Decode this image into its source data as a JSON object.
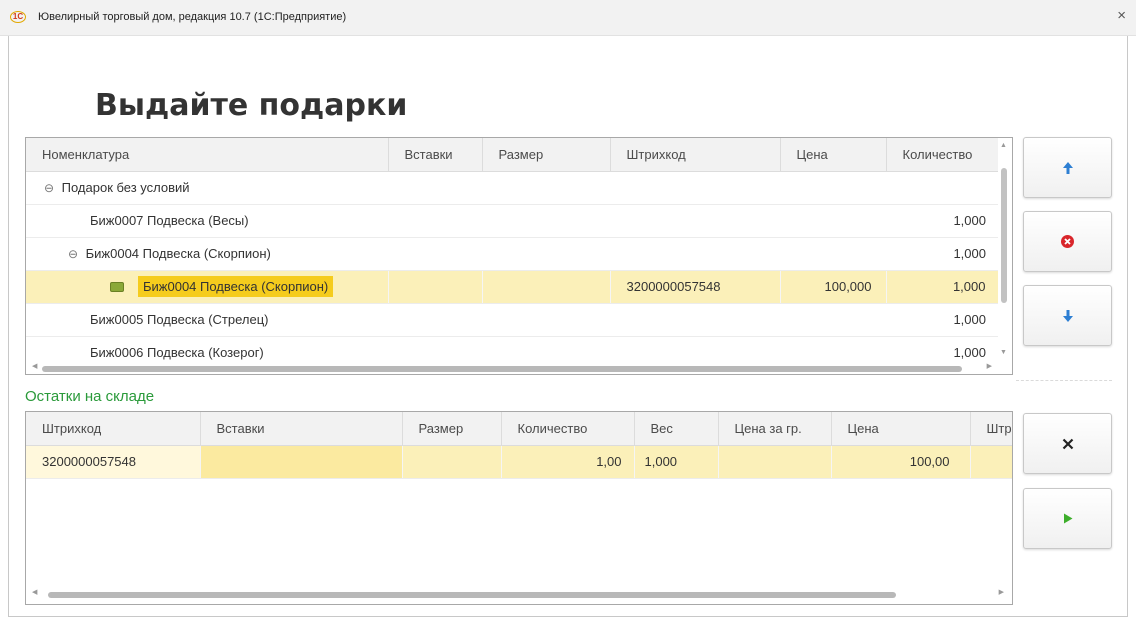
{
  "window": {
    "title": "Ювелирный торговый дом, редакция 10.7  (1С:Предприятие)",
    "logo_text": "1С",
    "close_symbol": "×"
  },
  "page_title": "Выдайте подарки",
  "gifts": {
    "columns": [
      "Номенклатура",
      "Вставки",
      "Размер",
      "Штрихкод",
      "Цена",
      "Количество"
    ],
    "rows": [
      {
        "name": "Подарок без условий",
        "group": true,
        "level": 0,
        "inserts": "",
        "size": "",
        "barcode": "",
        "price": "",
        "qty": ""
      },
      {
        "name": "Биж0007 Подвеска (Весы)",
        "group": false,
        "level": 1,
        "inserts": "",
        "size": "",
        "barcode": "",
        "price": "",
        "qty": "1,000"
      },
      {
        "name": "Биж0004 Подвеска (Скорпион)",
        "group": true,
        "level": 1,
        "inserts": "",
        "size": "",
        "barcode": "",
        "price": "",
        "qty": "1,000"
      },
      {
        "name": "Биж0004 Подвеска (Скорпион)",
        "group": false,
        "level": 2,
        "selected": true,
        "inserts": "",
        "size": "",
        "barcode": "3200000057548",
        "price": "100,000",
        "qty": "1,000"
      },
      {
        "name": "Биж0005 Подвеска (Стрелец)",
        "group": false,
        "level": 1,
        "inserts": "",
        "size": "",
        "barcode": "",
        "price": "",
        "qty": "1,000"
      },
      {
        "name": "Биж0006 Подвеска (Козерог)",
        "group": false,
        "level": 1,
        "inserts": "",
        "size": "",
        "barcode": "",
        "price": "",
        "qty": "1,000"
      }
    ]
  },
  "stock": {
    "label": "Остатки на складе",
    "columns": [
      "Штрихкод",
      "Вставки",
      "Размер",
      "Количество",
      "Вес",
      "Цена за гр.",
      "Цена",
      "Штр"
    ],
    "rows": [
      {
        "barcode": "3200000057548",
        "inserts": "",
        "size": "",
        "qty": "1,00",
        "weight": "1,000",
        "price_per_gram": "",
        "price": "100,00",
        "extra": ""
      }
    ]
  },
  "buttons": {
    "move_up": "arrow-up-icon",
    "delete": "delete-circle-icon",
    "move_down": "arrow-down-icon",
    "cancel": "cross-icon",
    "confirm": "play-icon"
  },
  "colors": {
    "accent_green": "#2a9a3a",
    "selection": "#fbf0b9",
    "highlight": "#f5cc1d",
    "arrow_blue": "#2d7fd3",
    "delete_red": "#d9262b",
    "play_green": "#3dae2b"
  }
}
